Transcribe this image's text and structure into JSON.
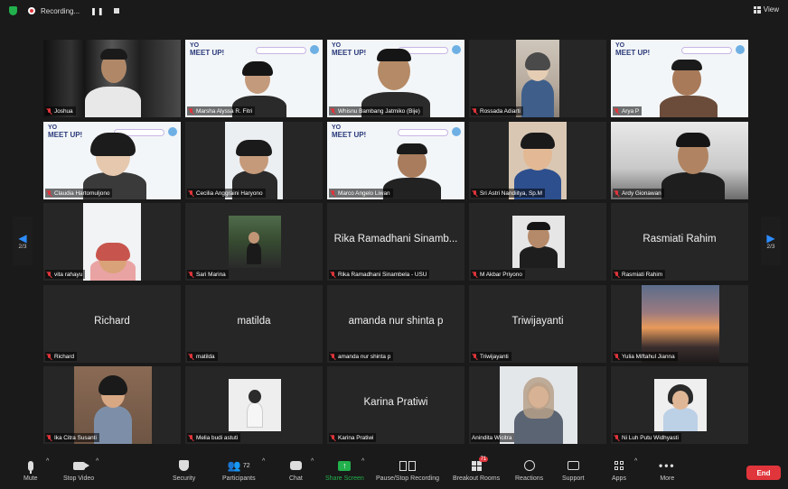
{
  "topbar": {
    "recording_label": "Recording...",
    "pause_symbol": "❚❚",
    "view_label": "View",
    "shield_color": "#22b14c",
    "record_color": "#e0353b"
  },
  "navigation": {
    "prev_page": "2/3",
    "next_page": "2/3",
    "arrow_color": "#2d8cff"
  },
  "participants": [
    {
      "name": "Joshua",
      "video": true
    },
    {
      "name": "Marsha Alyssa R. Fitri",
      "video": true
    },
    {
      "name": "Whisnu Bambang Jatmiko (Bije)",
      "video": true
    },
    {
      "name": "Rossada Adiarti",
      "video": true
    },
    {
      "name": "Arya P",
      "video": true
    },
    {
      "name": "Claudia Hartomuljono",
      "video": true
    },
    {
      "name": "Cecilia Anggraini Haryono",
      "video": true
    },
    {
      "name": "Marco Angelo Liwan",
      "video": true
    },
    {
      "name": "Sri Astri Nandiitya, Sp.M",
      "video": true
    },
    {
      "name": "Ardy Gionawan",
      "video": true
    },
    {
      "name": "vita rahayu",
      "video": true
    },
    {
      "name": "Sari Marina",
      "video": true
    },
    {
      "name": "Rika Ramadhani Sinambela - USU",
      "video": false,
      "display_name": "Rika Ramadhani Sinamb..."
    },
    {
      "name": "M Akbar Priyono",
      "video": true
    },
    {
      "name": "Rasmiati Rahim",
      "video": false,
      "display_name": "Rasmiati Rahim"
    },
    {
      "name": "Richard",
      "video": false,
      "display_name": "Richard"
    },
    {
      "name": "matilda",
      "video": false,
      "display_name": "matilda"
    },
    {
      "name": "amanda nur shinta p",
      "video": false,
      "display_name": "amanda nur shinta p"
    },
    {
      "name": "Triwijayanti",
      "video": false,
      "display_name": "Triwijayanti"
    },
    {
      "name": "Yulia Miftahul Jianna",
      "video": true
    },
    {
      "name": "Ika Citra Susanti",
      "video": true
    },
    {
      "name": "Melia budi astuti",
      "video": true
    },
    {
      "name": "Karina Pratiwi",
      "video": false,
      "display_name": "Karina Pratiwi"
    },
    {
      "name": "Anindita Wicitra",
      "video": true
    },
    {
      "name": "Ni Luh Putu Widhyasti",
      "video": true
    }
  ],
  "background": {
    "yo": "YO",
    "meetup": "MEET UP!"
  },
  "toolbar": {
    "mute": "Mute",
    "stop_video": "Stop Video",
    "security": "Security",
    "participants": "Participants",
    "participants_count": "72",
    "chat": "Chat",
    "share_screen": "Share Screen",
    "pause_recording": "Pause/Stop Recording",
    "breakout_rooms": "Breakout Rooms",
    "breakout_badge": "71",
    "reactions": "Reactions",
    "support": "Support",
    "apps": "Apps",
    "more": "More",
    "end": "End",
    "end_color": "#e0353b",
    "share_color": "#22b14c"
  }
}
